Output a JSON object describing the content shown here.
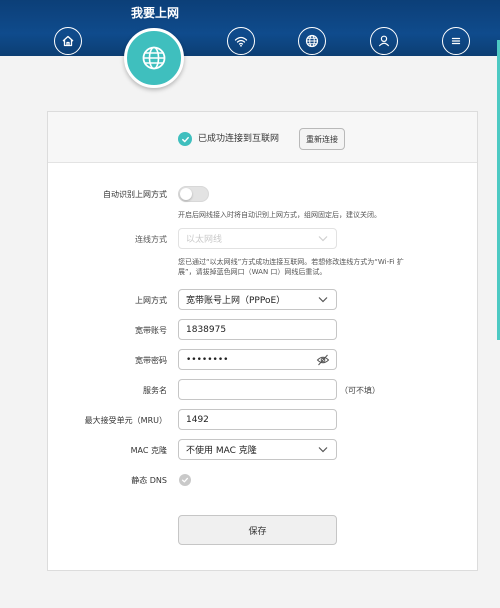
{
  "header": {
    "title": "我要上网",
    "nav": [
      {
        "name": "home",
        "icon": "home-icon"
      },
      {
        "name": "internet",
        "icon": "globe-icon",
        "active": true
      },
      {
        "name": "wifi",
        "icon": "wifi-icon"
      },
      {
        "name": "network",
        "icon": "network-globe-icon"
      },
      {
        "name": "user",
        "icon": "user-icon"
      },
      {
        "name": "more",
        "icon": "menu-icon"
      }
    ]
  },
  "status": {
    "text": "已成功连接到互联网",
    "reconnect_label": "重新连接"
  },
  "form": {
    "auto_detect": {
      "label": "自动识别上网方式",
      "enabled": false,
      "hint": "开启后网线接入时将自动识别上网方式，组网固定后，建议关闭。"
    },
    "connection_type": {
      "label": "连线方式",
      "value": "以太网线",
      "disabled": true,
      "hint": "您已通过“以太网线”方式成功连接互联网。若想修改连线方式为“Wi-Fi 扩展”，请拔掉蓝色网口（WAN 口）网线后重试。"
    },
    "internet_mode": {
      "label": "上网方式",
      "value": "宽带账号上网（PPPoE）"
    },
    "account": {
      "label": "宽带账号",
      "value": "1838975"
    },
    "password": {
      "label": "宽带密码",
      "value": "••••••••"
    },
    "service_name": {
      "label": "服务名",
      "value": "",
      "optional_note": "（可不填）"
    },
    "mru": {
      "label": "最大接受单元（MRU）",
      "value": "1492"
    },
    "mac_clone": {
      "label": "MAC 克隆",
      "value": "不使用 MAC 克隆"
    },
    "static_dns": {
      "label": "静态 DNS",
      "checked": false
    },
    "save_label": "保存"
  },
  "colors": {
    "accent": "#3fbfbe",
    "header": "#0f4b8c"
  }
}
